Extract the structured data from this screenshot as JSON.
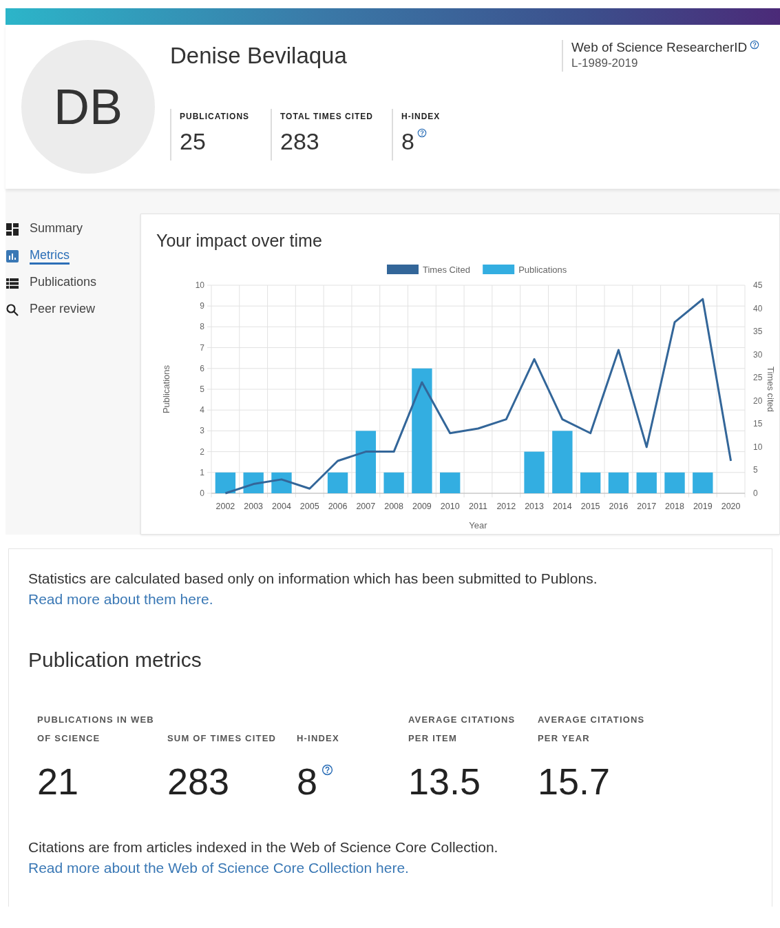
{
  "header": {
    "avatar_initials": "DB",
    "name": "Denise Bevilaqua",
    "researcher_id": {
      "label": "Web of Science ResearcherID",
      "has_help": true,
      "value": "L-1989-2019"
    },
    "stats": [
      {
        "label": "PUBLICATIONS",
        "value": "25",
        "has_help": false
      },
      {
        "label": "TOTAL TIMES CITED",
        "value": "283",
        "has_help": false
      },
      {
        "label": "H-INDEX",
        "value": "8",
        "has_help": true
      }
    ]
  },
  "sidebar": {
    "items": [
      {
        "label": "Summary",
        "selected": false
      },
      {
        "label": "Metrics",
        "selected": true
      },
      {
        "label": "Publications",
        "selected": false
      },
      {
        "label": "Peer review",
        "selected": false
      }
    ]
  },
  "impact": {
    "title": "Your impact over time",
    "chart_data": {
      "type": "bar",
      "grid": true,
      "legend": true,
      "xlabel": "Year",
      "ylabel": "Publications",
      "y2label": "Times cited",
      "categories": [
        "2002",
        "2003",
        "2004",
        "2005",
        "2006",
        "2007",
        "2008",
        "2009",
        "2010",
        "2011",
        "2012",
        "2013",
        "2014",
        "2015",
        "2016",
        "2017",
        "2018",
        "2019",
        "2020"
      ],
      "series": [
        {
          "name": "Times Cited",
          "type": "line",
          "axis": "y2",
          "color": "#336699",
          "values": [
            0,
            2,
            3,
            1,
            7,
            9,
            9,
            24,
            13,
            14,
            16,
            29,
            16,
            13,
            31,
            10,
            37,
            42,
            7
          ]
        },
        {
          "name": "Publications",
          "type": "bar",
          "color": "#33aee1",
          "values": [
            1,
            1,
            1,
            0,
            1,
            3,
            1,
            6,
            1,
            0,
            0,
            2,
            3,
            1,
            1,
            1,
            1,
            1,
            0
          ]
        }
      ],
      "ylim": [
        0,
        10
      ],
      "yticks": [
        0,
        1,
        2,
        3,
        4,
        5,
        6,
        7,
        8,
        9,
        10
      ],
      "y2lim": [
        0,
        45
      ],
      "y2ticks": [
        0,
        5,
        10,
        15,
        20,
        25,
        30,
        35,
        40,
        45
      ]
    }
  },
  "metrics": {
    "note": "Statistics are calculated based only on information which has been submitted to Publons.",
    "note_link": "Read more about them here.",
    "title": "Publication metrics",
    "items": [
      {
        "label": "PUBLICATIONS IN WEB OF SCIENCE",
        "value": "21",
        "has_help": false
      },
      {
        "label": "SUM OF TIMES CITED",
        "value": "283",
        "has_help": false
      },
      {
        "label": "H-INDEX",
        "value": "8",
        "has_help": true
      },
      {
        "label": "AVERAGE CITATIONS PER ITEM",
        "value": "13.5",
        "has_help": false
      },
      {
        "label": "AVERAGE CITATIONS PER YEAR",
        "value": "15.7",
        "has_help": false
      }
    ],
    "footer": "Citations are from articles indexed in the Web of Science Core Collection.",
    "footer_link": "Read more about the Web of Science Core Collection here."
  }
}
